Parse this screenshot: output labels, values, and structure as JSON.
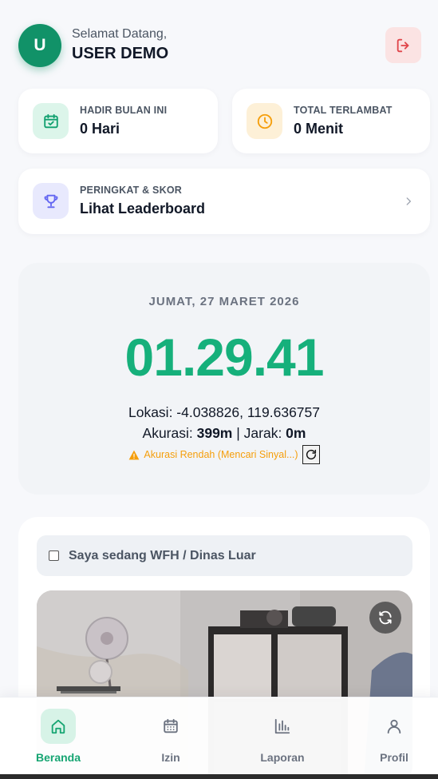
{
  "header": {
    "avatar_letter": "U",
    "greeting": "Selamat Datang,",
    "username": "USER DEMO",
    "logout_icon": "logout-icon"
  },
  "stats": [
    {
      "label": "HADIR BULAN INI",
      "value": "0 Hari",
      "icon": "calendar-check-icon",
      "accent": "#10a06f",
      "bg": "#dcf5ea"
    },
    {
      "label": "TOTAL TERLAMBAT",
      "value": "0 Menit",
      "icon": "clock-icon",
      "accent": "#f59e0b",
      "bg": "#fdf0d7"
    }
  ],
  "leaderboard": {
    "label": "PERINGKAT & SKOR",
    "value": "Lihat Leaderboard",
    "icon": "trophy-icon",
    "accent": "#6366f1"
  },
  "clock": {
    "date": "JUMAT, 27 MARET 2026",
    "time": "01.29.41",
    "location_prefix": "Lokasi: ",
    "location": "-4.038826, 119.636757",
    "accuracy_label": "Akurasi: ",
    "accuracy_value": "399m",
    "separator": " | Jarak: ",
    "distance_value": "0m",
    "warning": "Akurasi Rendah (Mencari Sinyal...)"
  },
  "attendance": {
    "wfh_label": "Saya sedang WFH / Dinas Luar",
    "wfh_checked": false
  },
  "nav": [
    {
      "label": "Beranda",
      "icon": "home-icon",
      "active": true
    },
    {
      "label": "Izin",
      "icon": "calendar-icon",
      "active": false
    },
    {
      "label": "Laporan",
      "icon": "bar-chart-icon",
      "active": false
    },
    {
      "label": "Profil",
      "icon": "user-icon",
      "active": false
    }
  ],
  "colors": {
    "brand": "#119268",
    "time_green": "#16b07b",
    "warning": "#f59e0b",
    "logout_red": "#e0454a"
  }
}
